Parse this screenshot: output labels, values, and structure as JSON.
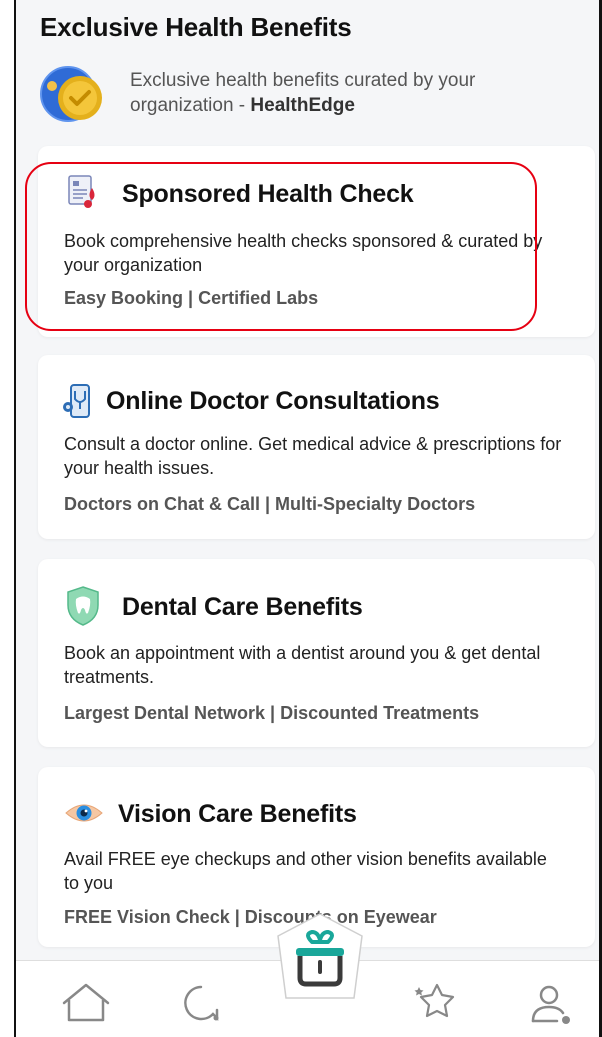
{
  "page": {
    "title": "Exclusive Health Benefits"
  },
  "organization": {
    "intro": "Exclusive health benefits curated by your organization - ",
    "name": "HealthEdge"
  },
  "benefits": [
    {
      "title": "Sponsored Health Check",
      "description": "Book comprehensive health checks sponsored & curated by your organization",
      "tags": "Easy Booking | Certified Labs",
      "icon": "health-report-icon"
    },
    {
      "title": "Online Doctor Consultations",
      "description": "Consult a doctor online. Get medical advice & prescriptions for your health issues.",
      "tags": "Doctors on Chat & Call | Multi-Specialty Doctors",
      "icon": "phone-stethoscope-icon"
    },
    {
      "title": "Dental Care Benefits",
      "description": "Book an appointment with a dentist around you & get dental treatments.",
      "tags": "Largest Dental Network | Discounted Treatments",
      "icon": "tooth-shield-icon"
    },
    {
      "title": "Vision Care Benefits",
      "description": "Avail FREE eye checkups and other vision benefits available to you",
      "tags": "FREE Vision Check | Discounts on Eyewear",
      "icon": "eye-icon"
    }
  ],
  "bottom_nav": {
    "items": [
      "home-icon",
      "chat-icon",
      "gift-box-icon",
      "stars-icon",
      "profile-icon"
    ],
    "active": "gift-box-icon"
  },
  "colors": {
    "highlight": "#e60012",
    "accent_teal": "#1aa79a",
    "background": "#f5f6f8"
  }
}
